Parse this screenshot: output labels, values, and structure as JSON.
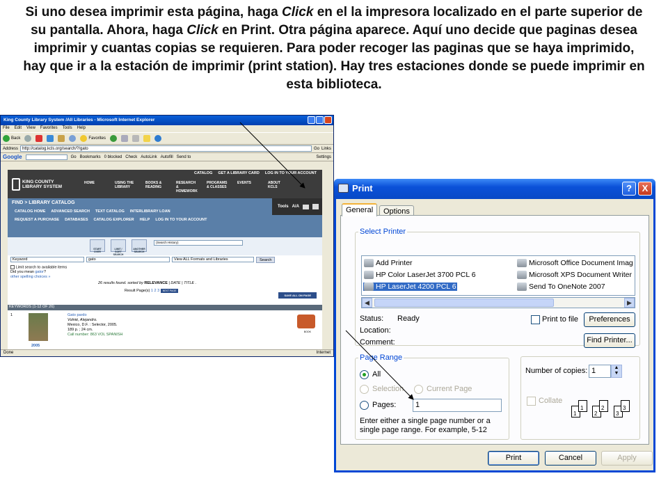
{
  "caption": {
    "p1": "Si uno desea imprimir esta página, haga ",
    "click1": "Click",
    "p2": " en el la impresora localizado en el parte superior de su pantalla. Ahora, haga ",
    "click2": "Click",
    "p3": " en Print. Otra página aparece. Aquí uno decide que paginas desea imprimir y cuantas copias se requieren.  Para poder recoger las paginas que se haya imprimido, hay que ir a la estación de imprimir (print station). Hay tres estaciones donde se puede imprimir en esta biblioteca."
  },
  "browser": {
    "title": "King County Library System /All Libraries - Microsoft Internet Explorer",
    "menu": [
      "File",
      "Edit",
      "View",
      "Favorites",
      "Tools",
      "Help"
    ],
    "back": "Back",
    "favorites": "Favorites",
    "address_label": "Address",
    "address": "http://catalog.kcls.org/search/?/gato",
    "go": "Go",
    "links": "Links",
    "google": "Google",
    "google_items": [
      "Go",
      "Bookmarks",
      "0 blocked",
      "Check",
      "AutoLink",
      "Autofill",
      "Send to"
    ],
    "settings": "Settings",
    "status_left": "Done",
    "status_right": "Internet"
  },
  "site": {
    "logo_line1": "KING COUNTY",
    "logo_line2": "LIBRARY SYSTEM",
    "toplinks": [
      "CATALOG",
      "GET A LIBRARY CARD",
      "LOG IN TO YOUR ACCOUNT"
    ],
    "nav": [
      "HOME",
      "USING THE LIBRARY",
      "BOOKS & READING",
      "RESEARCH & HOMEWORK",
      "PROGRAMS & CLASSES",
      "EVENTS",
      "ABOUT KCLS"
    ],
    "find": "FIND > LIBRARY CATALOG",
    "tools": "Tools",
    "tools_aa": "A/A",
    "row1": [
      "CATALOG HOME",
      "ADVANCED SEARCH",
      "TEXT CATALOG",
      "INTERLIBRARY LOAN"
    ],
    "row2": [
      "REQUEST A PURCHASE",
      "DATABASES",
      "CATALOG EXPLORER",
      "HELP",
      "LOG IN TO YOUR ACCOUNT"
    ],
    "icons": [
      "START OVER",
      "LIMIT / SORT SEARCH",
      "ANOTHER SEARCH"
    ],
    "history": "(Search History)",
    "search_type": "Keyword",
    "search_value": "gato",
    "search_scope": "View ALL Formats and Libraries",
    "search_btn": "Search",
    "limit": "Limit search to available items",
    "did_you_mean": "Did you mean ",
    "suggest": "gator",
    "other": "other spelling choices »",
    "results": "26 results found. sorted by ",
    "sort_rel": "RELEVANCE",
    "sort_rest": " | DATE | TITLE .",
    "pages_label": "Result Page(s)",
    "pages": "1 2 3",
    "next": "NEXT PAGE",
    "save_all": "SAVE ALL ON PAGE",
    "keywords": "KEYWORDS (1-12 OF 26)",
    "item_num": "1",
    "item_title": "Gato pardo",
    "item_author": "Volnié, Alejandro.",
    "item_pub": "Mexico, D.F. : Selector, 2005.",
    "item_desc": "189 p. ; 24 cm.",
    "item_call": "Call number: 863 VOL SPANISH",
    "item_year": "2005",
    "book": "BOOK"
  },
  "dialog": {
    "title": "Print",
    "help": "?",
    "close": "X",
    "tabs": [
      "General",
      "Options"
    ],
    "select_printer": "Select Printer",
    "printers_left": [
      "Add Printer",
      "HP Color LaserJet 3700 PCL 6",
      "HP LaserJet 4200 PCL 6"
    ],
    "printers_right": [
      "Microsoft Office Document Imag",
      "Microsoft XPS Document Writer",
      "Send To OneNote 2007"
    ],
    "status_label": "Status:",
    "status_value": "Ready",
    "location_label": "Location:",
    "comment_label": "Comment:",
    "print_to_file": "Print to file",
    "preferences": "Preferences",
    "find_printer": "Find Printer...",
    "page_range": "Page Range",
    "all": "All",
    "selection": "Selection",
    "current_page": "Current Page",
    "pages_label": "Pages:",
    "pages_value": "1",
    "hint": "Enter either a single page number or a single page range.  For example, 5-12",
    "copies_label": "Number of copies:",
    "copies_value": "1",
    "collate": "Collate",
    "print": "Print",
    "cancel": "Cancel",
    "apply": "Apply"
  },
  "colors": {
    "xp_blue": "#0047d4",
    "legend": "#0046d5",
    "kcls_blue": "#5a7fa8"
  }
}
